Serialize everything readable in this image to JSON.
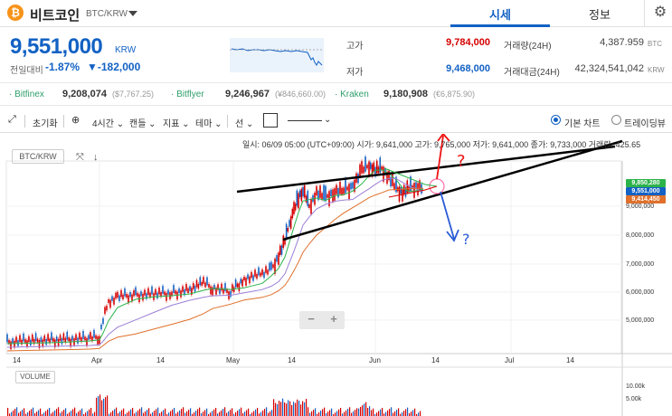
{
  "header": {
    "coin_symbol_glyph": "₿",
    "coin_name": "비트코인",
    "pair": "BTC/KRW",
    "tabs": [
      {
        "label": "시세",
        "active": true
      },
      {
        "label": "정보",
        "active": false
      }
    ]
  },
  "price": {
    "current": "9,551,000",
    "unit": "KRW",
    "change_label": "전일대비",
    "change_pct": "-1.87%",
    "change_val": "▼-182,000",
    "high_label": "고가",
    "high": "9,784,000",
    "low_label": "저가",
    "low": "9,468,000",
    "volume_label": "거래량(24H)",
    "volume": "4,387.959",
    "volume_unit": "BTC",
    "turnover_label": "거래대금(24H)",
    "turnover": "42,324,541,042",
    "turnover_unit": "KRW"
  },
  "exchanges": [
    {
      "name": "· Bitfinex",
      "price": "9,208,074",
      "ref": "($7,767.25)"
    },
    {
      "name": "· Bitflyer",
      "price": "9,246,967",
      "ref": "(¥846,660.00)"
    },
    {
      "name": "· Kraken",
      "price": "9,180,908",
      "ref": "(€6,875.90)"
    }
  ],
  "toolbar": {
    "reset": "초기화",
    "interval": "4시간",
    "candle": "캔들",
    "indicator": "지표",
    "theme": "테마",
    "line": "선",
    "basic_chart": "기본 차트",
    "trading_view": "트레이딩뷰"
  },
  "chart": {
    "ohlc_line": "일시: 06/09 05:00 (UTC+09:00) 시가: 9,641,000 고가: 9,765,000 저가: 9,641,000 종가: 9,733,000 거래량: 425.65",
    "symbol_tag": "BTC/KRW",
    "volume_tag": "VOLUME",
    "zoom_minus": "−",
    "zoom_plus": "+",
    "x_labels": [
      "14",
      "Apr",
      "14",
      "May",
      "14",
      "Jun",
      "14",
      "Jul",
      "14"
    ],
    "y_labels": [
      "9,000,000",
      "8,000,000",
      "7,000,000",
      "6,000,000",
      "5,000,000"
    ],
    "price_tags": [
      {
        "value": "9,850,280",
        "color": "#2bb34a"
      },
      {
        "value": "9,551,000",
        "color": "#1261c4"
      },
      {
        "value": "9,414,450",
        "color": "#e0702b"
      }
    ],
    "vol_labels": [
      "10.00k",
      "5.00k"
    ],
    "annotation_question": "?"
  },
  "colors": {
    "accent": "#1261c4",
    "up": "#d60000",
    "down": "#1261c4",
    "exchange": "#2f9e6b"
  }
}
